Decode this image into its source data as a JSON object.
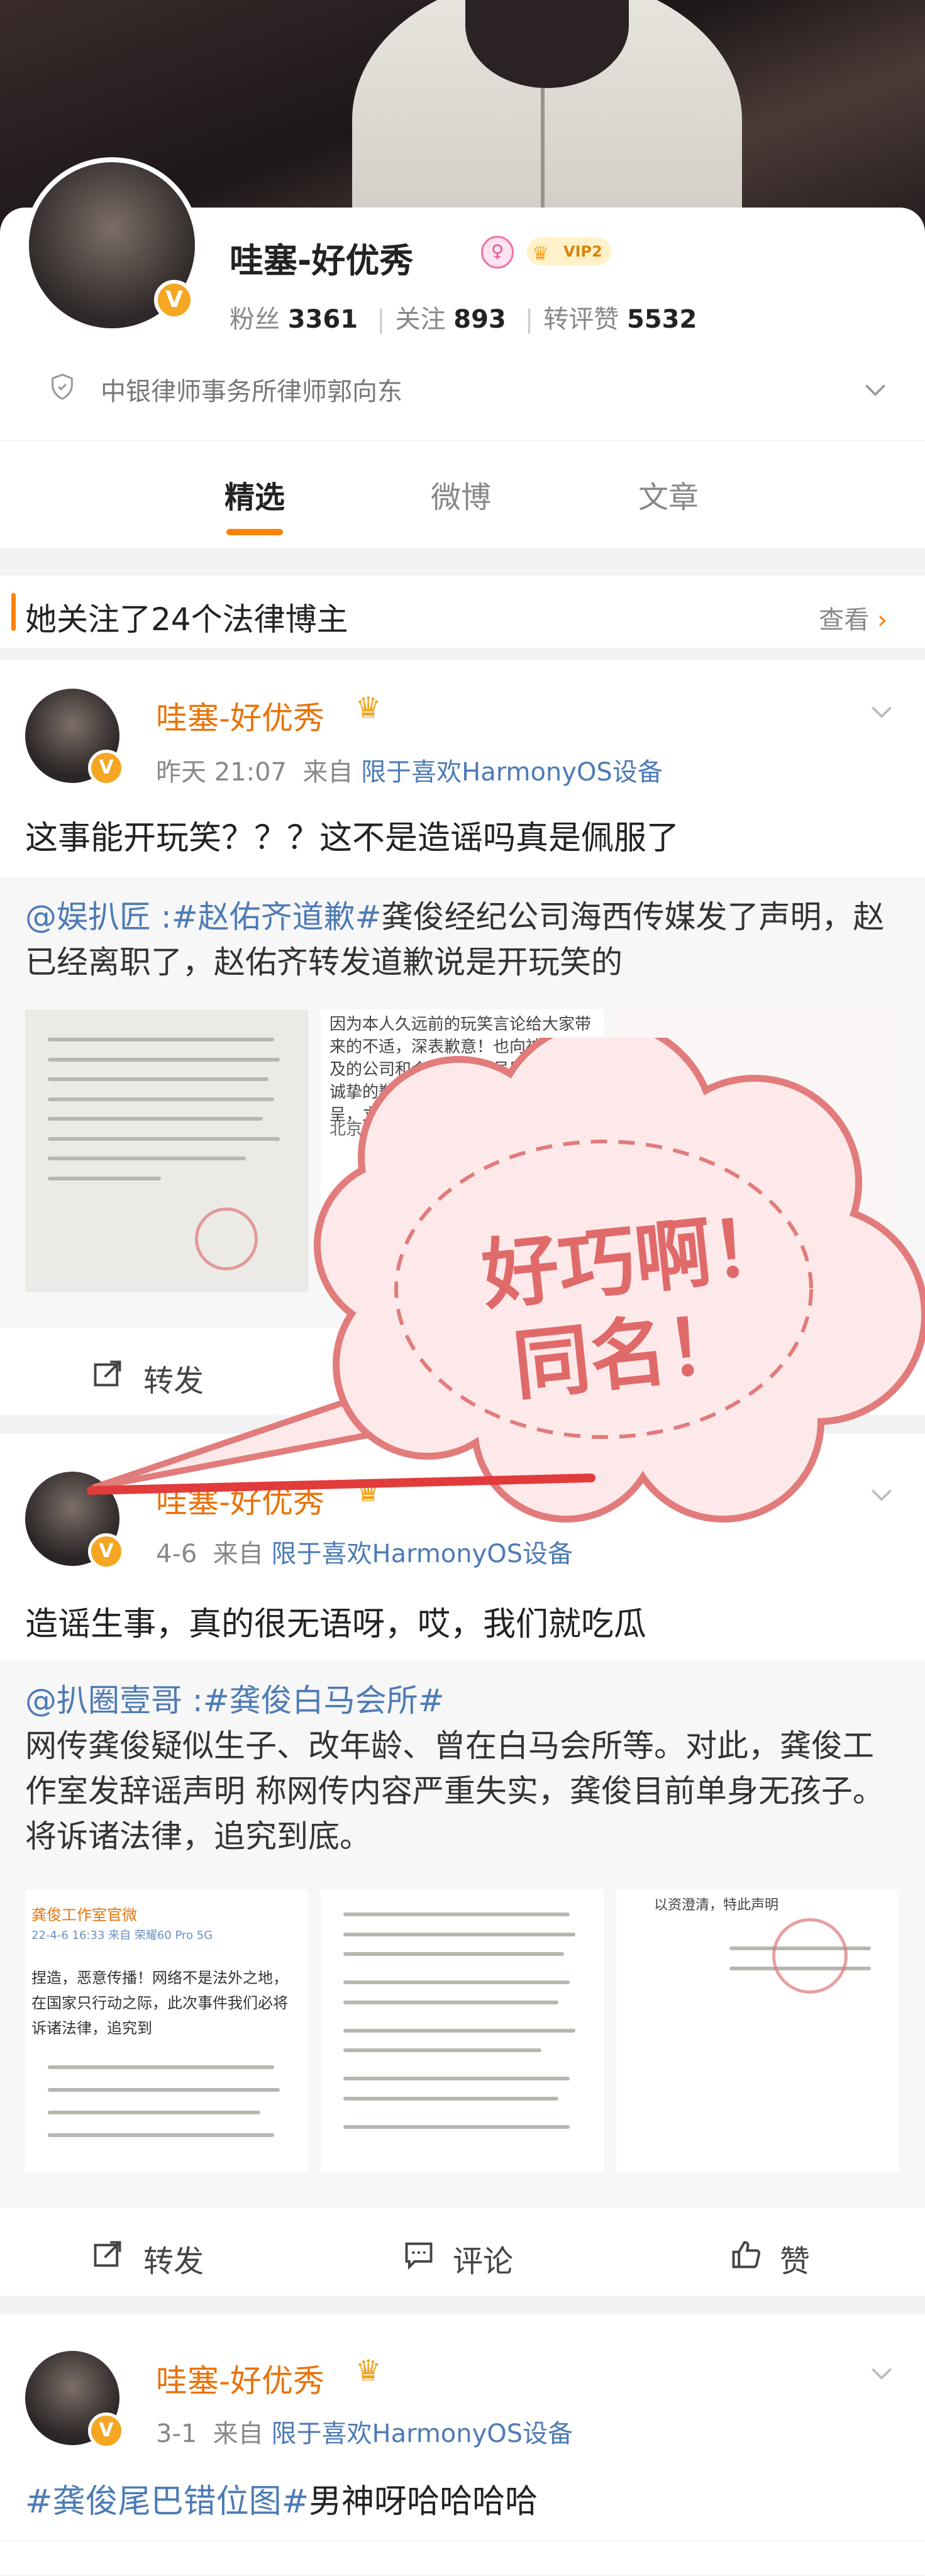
{
  "profile": {
    "name": "哇塞-好优秀",
    "vip_label": "VIP2",
    "stats": [
      {
        "label": "粉丝",
        "value": "3361"
      },
      {
        "label": "关注",
        "value": "893"
      },
      {
        "label": "转评赞",
        "value": "5532"
      }
    ],
    "certification": "中银律师事务所律师郭向东"
  },
  "tabs": [
    {
      "label": "精选",
      "active": true
    },
    {
      "label": "微博",
      "active": false
    },
    {
      "label": "文章",
      "active": false
    }
  ],
  "notice": {
    "text": "她关注了24个法律博主",
    "more": "查看"
  },
  "posts": [
    {
      "author": "哇塞-好优秀",
      "time": "昨天 21:07",
      "from_label": "来自",
      "source": "限于喜欢HarmonyOS设备",
      "text": "这事能开玩笑？？？这不是造谣吗真是佩服了",
      "quote": {
        "author": "@娱扒匠",
        "sep": " :",
        "hashtag": "#赵佑齐道歉#",
        "text": "龚俊经纪公司海西传媒发了声明，赵已经离职了，赵佑齐转发道歉说是开玩笑的"
      },
      "image_caption": "因为本人久远前的玩笑言论给大家带来的不适，深表歉意！也向被此事波及的公司和合作过的演员朋友表示最诚挚的歉意！本人已向公司提交辞呈，立刻离职、关闭微博。",
      "image_caption_footer": "北京海西传媒"
    },
    {
      "author": "哇塞-好优秀",
      "time": "4-6",
      "from_label": "来自",
      "source": "限于喜欢HarmonyOS设备",
      "text": "造谣生事，真的很无语呀，哎，我们就吃瓜",
      "quote": {
        "author": "@扒圈壹哥",
        "sep": " :",
        "hashtag": "#龚俊白马会所#",
        "text": "网传龚俊疑似生子、改年龄、曾在白马会所等。对此，龚俊工作室发辞谣声明 称网传内容严重失实，龚俊目前单身无孩子。将诉诸法律，追究到底。"
      },
      "image_header": "龚俊工作室官微",
      "image_meta": "22-4-6 16:33  来自 荣耀60 Pro 5G",
      "image_text": "捏造，恶意传播！网络不是法外之地，在国家只行动之际，此次事件我们必将诉诸法律，追究到",
      "image_footer": "以资澄清，特此声明"
    },
    {
      "author": "哇塞-好优秀",
      "time": "3-1",
      "from_label": "来自",
      "source": "限于喜欢HarmonyOS设备",
      "hashtag": "#龚俊尾巴错位图#",
      "text": "男神呀哈哈哈哈"
    }
  ],
  "actions": {
    "repost": "转发",
    "comment": "评论",
    "like": "赞"
  },
  "sticker": {
    "line1": "好巧啊！",
    "line2": "同名！"
  },
  "colors": {
    "accent": "#ff8200",
    "author": "#e8740c",
    "link": "#4d7bb5",
    "sticker": "#e06a6a"
  }
}
